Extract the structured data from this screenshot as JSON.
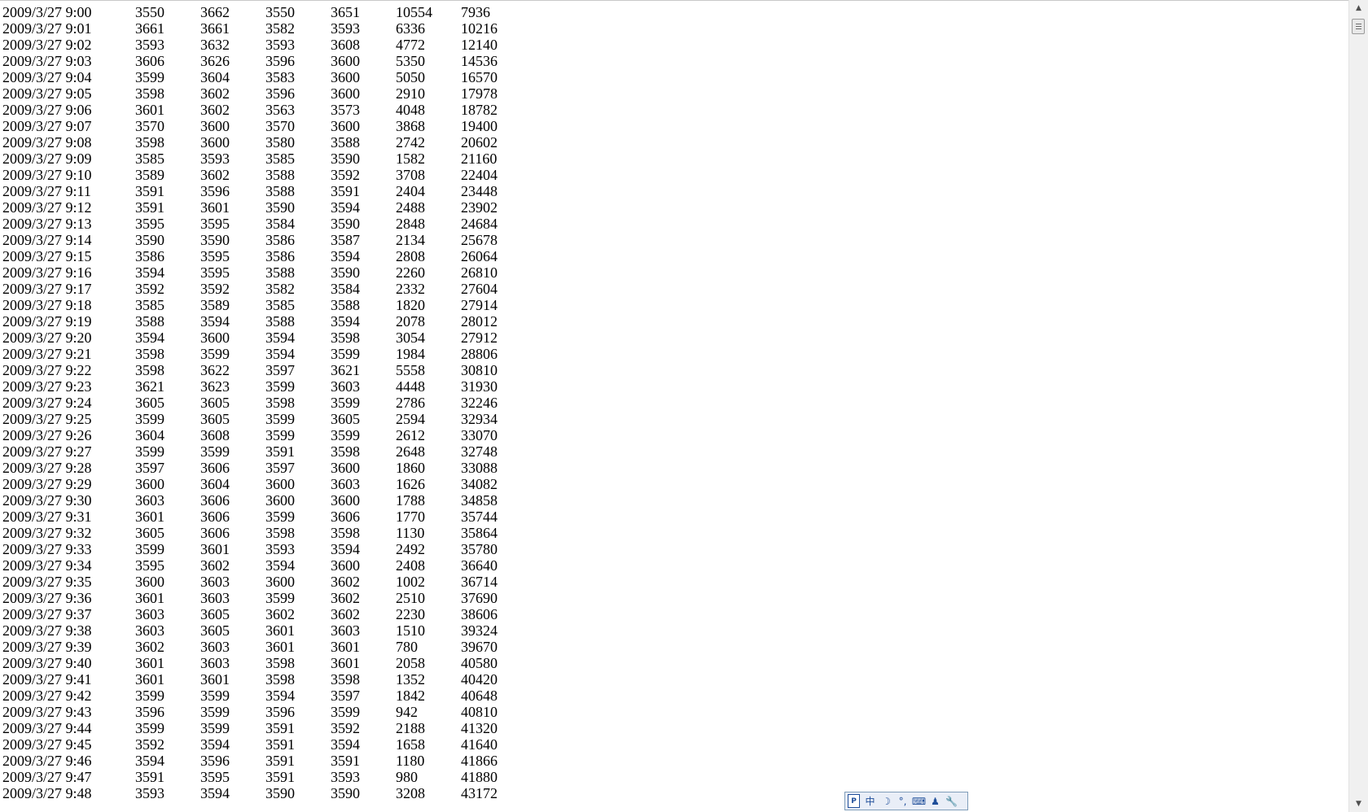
{
  "rows": [
    [
      "2009/3/27 9:00",
      "3550",
      "3662",
      "3550",
      "3651",
      "10554",
      "7936"
    ],
    [
      "2009/3/27 9:01",
      "3661",
      "3661",
      "3582",
      "3593",
      "6336",
      "10216"
    ],
    [
      "2009/3/27 9:02",
      "3593",
      "3632",
      "3593",
      "3608",
      "4772",
      "12140"
    ],
    [
      "2009/3/27 9:03",
      "3606",
      "3626",
      "3596",
      "3600",
      "5350",
      "14536"
    ],
    [
      "2009/3/27 9:04",
      "3599",
      "3604",
      "3583",
      "3600",
      "5050",
      "16570"
    ],
    [
      "2009/3/27 9:05",
      "3598",
      "3602",
      "3596",
      "3600",
      "2910",
      "17978"
    ],
    [
      "2009/3/27 9:06",
      "3601",
      "3602",
      "3563",
      "3573",
      "4048",
      "18782"
    ],
    [
      "2009/3/27 9:07",
      "3570",
      "3600",
      "3570",
      "3600",
      "3868",
      "19400"
    ],
    [
      "2009/3/27 9:08",
      "3598",
      "3600",
      "3580",
      "3588",
      "2742",
      "20602"
    ],
    [
      "2009/3/27 9:09",
      "3585",
      "3593",
      "3585",
      "3590",
      "1582",
      "21160"
    ],
    [
      "2009/3/27 9:10",
      "3589",
      "3602",
      "3588",
      "3592",
      "3708",
      "22404"
    ],
    [
      "2009/3/27 9:11",
      "3591",
      "3596",
      "3588",
      "3591",
      "2404",
      "23448"
    ],
    [
      "2009/3/27 9:12",
      "3591",
      "3601",
      "3590",
      "3594",
      "2488",
      "23902"
    ],
    [
      "2009/3/27 9:13",
      "3595",
      "3595",
      "3584",
      "3590",
      "2848",
      "24684"
    ],
    [
      "2009/3/27 9:14",
      "3590",
      "3590",
      "3586",
      "3587",
      "2134",
      "25678"
    ],
    [
      "2009/3/27 9:15",
      "3586",
      "3595",
      "3586",
      "3594",
      "2808",
      "26064"
    ],
    [
      "2009/3/27 9:16",
      "3594",
      "3595",
      "3588",
      "3590",
      "2260",
      "26810"
    ],
    [
      "2009/3/27 9:17",
      "3592",
      "3592",
      "3582",
      "3584",
      "2332",
      "27604"
    ],
    [
      "2009/3/27 9:18",
      "3585",
      "3589",
      "3585",
      "3588",
      "1820",
      "27914"
    ],
    [
      "2009/3/27 9:19",
      "3588",
      "3594",
      "3588",
      "3594",
      "2078",
      "28012"
    ],
    [
      "2009/3/27 9:20",
      "3594",
      "3600",
      "3594",
      "3598",
      "3054",
      "27912"
    ],
    [
      "2009/3/27 9:21",
      "3598",
      "3599",
      "3594",
      "3599",
      "1984",
      "28806"
    ],
    [
      "2009/3/27 9:22",
      "3598",
      "3622",
      "3597",
      "3621",
      "5558",
      "30810"
    ],
    [
      "2009/3/27 9:23",
      "3621",
      "3623",
      "3599",
      "3603",
      "4448",
      "31930"
    ],
    [
      "2009/3/27 9:24",
      "3605",
      "3605",
      "3598",
      "3599",
      "2786",
      "32246"
    ],
    [
      "2009/3/27 9:25",
      "3599",
      "3605",
      "3599",
      "3605",
      "2594",
      "32934"
    ],
    [
      "2009/3/27 9:26",
      "3604",
      "3608",
      "3599",
      "3599",
      "2612",
      "33070"
    ],
    [
      "2009/3/27 9:27",
      "3599",
      "3599",
      "3591",
      "3598",
      "2648",
      "32748"
    ],
    [
      "2009/3/27 9:28",
      "3597",
      "3606",
      "3597",
      "3600",
      "1860",
      "33088"
    ],
    [
      "2009/3/27 9:29",
      "3600",
      "3604",
      "3600",
      "3603",
      "1626",
      "34082"
    ],
    [
      "2009/3/27 9:30",
      "3603",
      "3606",
      "3600",
      "3600",
      "1788",
      "34858"
    ],
    [
      "2009/3/27 9:31",
      "3601",
      "3606",
      "3599",
      "3606",
      "1770",
      "35744"
    ],
    [
      "2009/3/27 9:32",
      "3605",
      "3606",
      "3598",
      "3598",
      "1130",
      "35864"
    ],
    [
      "2009/3/27 9:33",
      "3599",
      "3601",
      "3593",
      "3594",
      "2492",
      "35780"
    ],
    [
      "2009/3/27 9:34",
      "3595",
      "3602",
      "3594",
      "3600",
      "2408",
      "36640"
    ],
    [
      "2009/3/27 9:35",
      "3600",
      "3603",
      "3600",
      "3602",
      "1002",
      "36714"
    ],
    [
      "2009/3/27 9:36",
      "3601",
      "3603",
      "3599",
      "3602",
      "2510",
      "37690"
    ],
    [
      "2009/3/27 9:37",
      "3603",
      "3605",
      "3602",
      "3602",
      "2230",
      "38606"
    ],
    [
      "2009/3/27 9:38",
      "3603",
      "3605",
      "3601",
      "3603",
      "1510",
      "39324"
    ],
    [
      "2009/3/27 9:39",
      "3602",
      "3603",
      "3601",
      "3601",
      "780",
      "39670"
    ],
    [
      "2009/3/27 9:40",
      "3601",
      "3603",
      "3598",
      "3601",
      "2058",
      "40580"
    ],
    [
      "2009/3/27 9:41",
      "3601",
      "3601",
      "3598",
      "3598",
      "1352",
      "40420"
    ],
    [
      "2009/3/27 9:42",
      "3599",
      "3599",
      "3594",
      "3597",
      "1842",
      "40648"
    ],
    [
      "2009/3/27 9:43",
      "3596",
      "3599",
      "3596",
      "3599",
      "942",
      "40810"
    ],
    [
      "2009/3/27 9:44",
      "3599",
      "3599",
      "3591",
      "3592",
      "2188",
      "41320"
    ],
    [
      "2009/3/27 9:45",
      "3592",
      "3594",
      "3591",
      "3594",
      "1658",
      "41640"
    ],
    [
      "2009/3/27 9:46",
      "3594",
      "3596",
      "3591",
      "3591",
      "1180",
      "41866"
    ],
    [
      "2009/3/27 9:47",
      "3591",
      "3595",
      "3591",
      "3593",
      "980",
      "41880"
    ],
    [
      "2009/3/27 9:48",
      "3593",
      "3594",
      "3590",
      "3590",
      "3208",
      "43172"
    ]
  ],
  "scrollbar": {
    "up_arrow": "▲",
    "down_arrow": "▼"
  },
  "ime_toolbar": {
    "items": [
      {
        "icon": "ime-logo-icon",
        "glyph": "P"
      },
      {
        "icon": "chinese-mode-icon",
        "glyph": "中"
      },
      {
        "icon": "half-width-moon-icon",
        "glyph": "☽"
      },
      {
        "icon": "punctuation-icon",
        "glyph": "°,"
      },
      {
        "icon": "soft-keyboard-icon",
        "glyph": "⌨"
      },
      {
        "icon": "user-icon",
        "glyph": "♟"
      },
      {
        "icon": "settings-wrench-icon",
        "glyph": "🔧"
      }
    ]
  }
}
